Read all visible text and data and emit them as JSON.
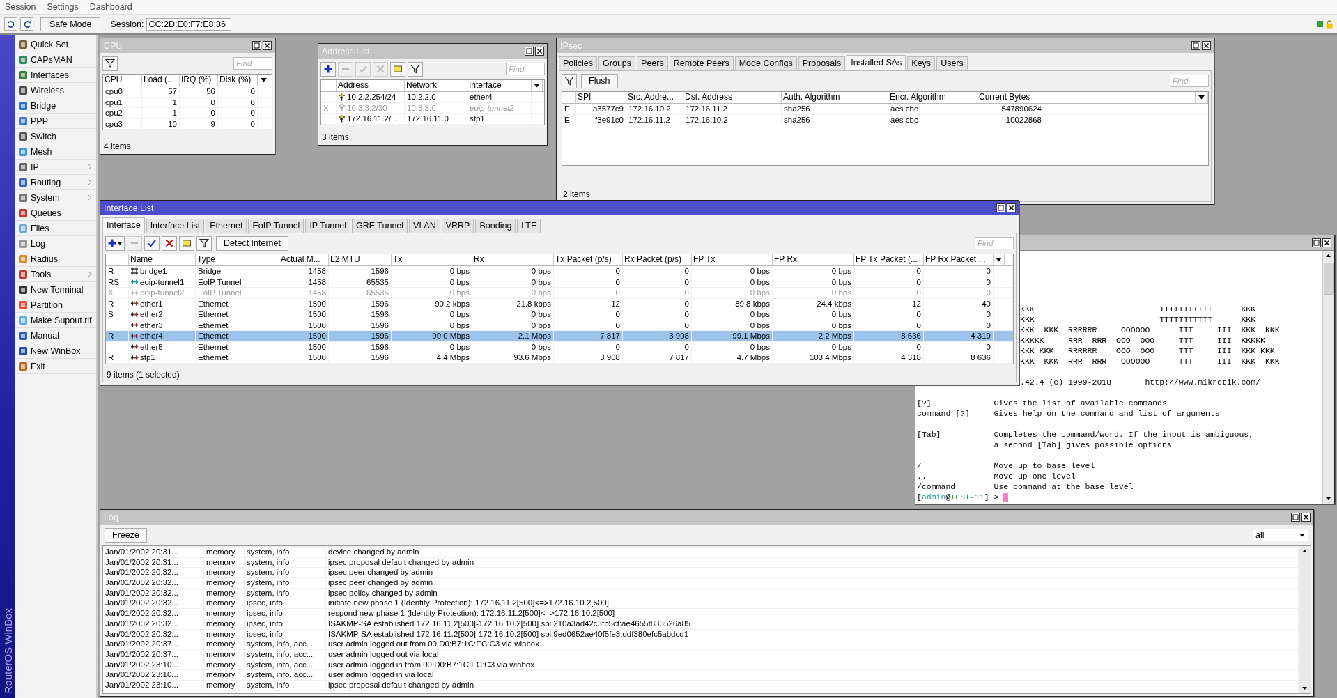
{
  "menu": [
    "Session",
    "Settings",
    "Dashboard"
  ],
  "toolbar": {
    "safe_mode": "Safe Mode",
    "session_label": "Session:",
    "session_value": "CC:2D:E0:F7:E8:86"
  },
  "sidebar": {
    "brand": "RouterOS WinBox",
    "items": [
      {
        "label": "Quick Set",
        "has_submenu": false
      },
      {
        "label": "CAPsMAN",
        "has_submenu": false
      },
      {
        "label": "Interfaces",
        "has_submenu": false
      },
      {
        "label": "Wireless",
        "has_submenu": false
      },
      {
        "label": "Bridge",
        "has_submenu": false
      },
      {
        "label": "PPP",
        "has_submenu": false
      },
      {
        "label": "Switch",
        "has_submenu": false
      },
      {
        "label": "Mesh",
        "has_submenu": false
      },
      {
        "label": "IP",
        "has_submenu": true
      },
      {
        "label": "Routing",
        "has_submenu": true
      },
      {
        "label": "System",
        "has_submenu": true
      },
      {
        "label": "Queues",
        "has_submenu": false
      },
      {
        "label": "Files",
        "has_submenu": false
      },
      {
        "label": "Log",
        "has_submenu": false
      },
      {
        "label": "Radius",
        "has_submenu": false
      },
      {
        "label": "Tools",
        "has_submenu": true
      },
      {
        "label": "New Terminal",
        "has_submenu": false
      },
      {
        "label": "Partition",
        "has_submenu": false
      },
      {
        "label": "Make Supout.rif",
        "has_submenu": false
      },
      {
        "label": "Manual",
        "has_submenu": false
      },
      {
        "label": "New WinBox",
        "has_submenu": false
      },
      {
        "label": "Exit",
        "has_submenu": false
      }
    ]
  },
  "cpu_window": {
    "title": "CPU",
    "find": {
      "placeholder": "Find"
    },
    "columns": [
      "CPU",
      "Load (...",
      "IRQ (%)",
      "Disk (%)"
    ],
    "rows": [
      [
        "cpu0",
        "57",
        "56",
        "0"
      ],
      [
        "cpu1",
        "1",
        "0",
        "0"
      ],
      [
        "cpu2",
        "1",
        "0",
        "0"
      ],
      [
        "cpu3",
        "10",
        "9",
        "0"
      ]
    ],
    "footer": "4 items"
  },
  "address_window": {
    "title": "Address List",
    "find": {
      "placeholder": "Find"
    },
    "tools": [
      {
        "kind": "add",
        "disabled": false
      },
      {
        "kind": "remove",
        "disabled": true
      },
      {
        "kind": "enable",
        "disabled": true
      },
      {
        "kind": "disable",
        "disabled": true
      },
      {
        "kind": "comment",
        "disabled": false
      },
      {
        "kind": "filter",
        "disabled": false
      }
    ],
    "columns": [
      "Address",
      "Network",
      "Interface"
    ],
    "rows": [
      {
        "address": "10.2.2.254/24",
        "network": "10.2.2.0",
        "interface": "ether4",
        "disabled": false
      },
      {
        "flag": "X",
        "address": "10.3.3.2/30",
        "network": "10.3.3.0",
        "interface": "eoip-tunnel2",
        "disabled": true
      },
      {
        "address": "172.16.11.2/...",
        "network": "172.16.11.0",
        "interface": "sfp1",
        "disabled": false
      }
    ],
    "footer": "3 items"
  },
  "ipsec_window": {
    "title": "IPsec",
    "tabs": [
      {
        "label": "Policies",
        "selected": false
      },
      {
        "label": "Groups",
        "selected": false
      },
      {
        "label": "Peers",
        "selected": false
      },
      {
        "label": "Remote Peers",
        "selected": false
      },
      {
        "label": "Mode Configs",
        "selected": false
      },
      {
        "label": "Proposals",
        "selected": false
      },
      {
        "label": "Installed SAs",
        "selected": true
      },
      {
        "label": "Keys",
        "selected": false
      },
      {
        "label": "Users",
        "selected": false
      }
    ],
    "flush": "Flush",
    "find": {
      "placeholder": "Find"
    },
    "columns": [
      "SPI",
      "Src. Addre...",
      "Dst. Address",
      "Auth. Algorithm",
      "Encr. Algorithm",
      "Current Bytes"
    ],
    "rows": [
      {
        "flag": "E",
        "cells": [
          "a3577c9",
          "172.16.10.2",
          "172.16.11.2",
          "sha256",
          "aes cbc",
          "547890624"
        ]
      },
      {
        "flag": "E",
        "cells": [
          "f3e91c0",
          "172.16.11.2",
          "172.16.10.2",
          "sha256",
          "aes cbc",
          "10022868"
        ]
      }
    ],
    "footer": "2 items"
  },
  "interface_window": {
    "title": "Interface List",
    "tabs": [
      {
        "label": "Interface",
        "selected": true
      },
      {
        "label": "Interface List",
        "selected": false
      },
      {
        "label": "Ethernet",
        "selected": false
      },
      {
        "label": "EoIP Tunnel",
        "selected": false
      },
      {
        "label": "IP Tunnel",
        "selected": false
      },
      {
        "label": "GRE Tunnel",
        "selected": false
      },
      {
        "label": "VLAN",
        "selected": false
      },
      {
        "label": "VRRP",
        "selected": false
      },
      {
        "label": "Bonding",
        "selected": false
      },
      {
        "label": "LTE",
        "selected": false
      }
    ],
    "tools": [
      {
        "kind": "add",
        "disabled": false
      },
      {
        "kind": "remove",
        "disabled": true
      },
      {
        "kind": "enable",
        "disabled": false
      },
      {
        "kind": "disable",
        "disabled": false
      },
      {
        "kind": "comment",
        "disabled": false
      },
      {
        "kind": "filter",
        "disabled": false
      }
    ],
    "detect": "Detect Internet",
    "find": {
      "placeholder": "Find"
    },
    "columns": [
      "Name",
      "Type",
      "Actual M...",
      "L2 MTU",
      "Tx",
      "Rx",
      "Tx Packet (p/s)",
      "Rx Packet (p/s)",
      "FP Tx",
      "FP Rx",
      "FP Tx Packet (...",
      "FP Rx Packet ..."
    ],
    "rows": [
      {
        "flag": "R",
        "kind": "bridge",
        "name": "bridge1",
        "type": "Bridge",
        "values": [
          "1458",
          "1596",
          "0 bps",
          "0 bps",
          "0",
          "0",
          "0 bps",
          "0 bps",
          "0",
          "0"
        ],
        "disabled": false,
        "selected": false
      },
      {
        "flag": "RS",
        "kind": "tunnel",
        "name": "eoip-tunnel1",
        "type": "EoIP Tunnel",
        "values": [
          "1458",
          "65535",
          "0 bps",
          "0 bps",
          "0",
          "0",
          "0 bps",
          "0 bps",
          "0",
          "0"
        ],
        "disabled": false,
        "selected": false
      },
      {
        "flag": "X",
        "kind": "tunnel",
        "name": "eoip-tunnel2",
        "type": "EoIP Tunnel",
        "values": [
          "1458",
          "65535",
          "0 bps",
          "0 bps",
          "0",
          "0",
          "0 bps",
          "0 bps",
          "0",
          "0"
        ],
        "disabled": true,
        "selected": false
      },
      {
        "flag": "R",
        "kind": "ethernet",
        "name": "ether1",
        "type": "Ethernet",
        "values": [
          "1500",
          "1596",
          "90.2 kbps",
          "21.8 kbps",
          "12",
          "0",
          "89.8 kbps",
          "24.4 kbps",
          "12",
          "40"
        ],
        "disabled": false,
        "selected": false
      },
      {
        "flag": "S",
        "kind": "ethernet",
        "name": "ether2",
        "type": "Ethernet",
        "values": [
          "1500",
          "1596",
          "0 bps",
          "0 bps",
          "0",
          "0",
          "0 bps",
          "0 bps",
          "0",
          "0"
        ],
        "disabled": false,
        "selected": false
      },
      {
        "kind": "ethernet",
        "name": "ether3",
        "type": "Ethernet",
        "values": [
          "1500",
          "1596",
          "0 bps",
          "0 bps",
          "0",
          "0",
          "0 bps",
          "0 bps",
          "0",
          "0"
        ],
        "disabled": false,
        "selected": false
      },
      {
        "flag": "R",
        "kind": "ethernet",
        "name": "ether4",
        "type": "Ethernet",
        "values": [
          "1500",
          "1596",
          "90.0 Mbps",
          "2.1 Mbps",
          "7 817",
          "3 908",
          "99.1 Mbps",
          "2.2 Mbps",
          "8 636",
          "4 319"
        ],
        "disabled": false,
        "selected": true
      },
      {
        "kind": "ethernet",
        "name": "ether5",
        "type": "Ethernet",
        "values": [
          "1500",
          "1596",
          "0 bps",
          "0 bps",
          "0",
          "0",
          "0 bps",
          "0 bps",
          "0",
          "0"
        ],
        "disabled": false,
        "selected": false
      },
      {
        "flag": "R",
        "kind": "ethernet",
        "name": "sfp1",
        "type": "Ethernet",
        "values": [
          "1500",
          "1596",
          "4.4 Mbps",
          "93.6 Mbps",
          "3 908",
          "7 817",
          "4.7 Mbps",
          "103.4 Mbps",
          "4 318",
          "8 636"
        ],
        "disabled": false,
        "selected": false
      }
    ],
    "footer": "9 items (1 selected)"
  },
  "terminal": {
    "banner": [
      "KKK                          TTTTTTTTTTT      KKK",
      "KKK                          TTTTTTTTTTT      KKK",
      "KKK  KKK  RRRRRR     OOOOOO      TTT     III  KKK  KKK",
      "KKKKK     RRR  RRR  OOO  OOO     TTT     III  KKKKK",
      "KKK KKK   RRRRRR    OOO  OOO     TTT     III  KKK KKK",
      "KKK  KKK  RRR  RRR   OOOOOO      TTT     III  KKK  KKK"
    ],
    "version": ".42.4 (c) 1999-2018       http://www.mikrotik.com/",
    "help_groups": [
      [
        "[?]             Gives the list of available commands",
        "command [?]     Gives help on the command and list of arguments"
      ],
      [
        "[Tab]           Completes the command/word. If the input is ambiguous,",
        "                a second [Tab] gives possible options"
      ],
      [
        "/               Move up to base level",
        "..              Move up one level",
        "/command        Use command at the base level"
      ]
    ],
    "prompt": {
      "open": "[",
      "user": "admin",
      "at": "@",
      "host": "TEST-11",
      "close": "] >"
    }
  },
  "log_window": {
    "title": "Log",
    "freeze": "Freeze",
    "filter": "all",
    "rows": [
      [
        "Jan/01/2002 20:31...",
        "memory",
        "system, info",
        "device changed by admin"
      ],
      [
        "Jan/01/2002 20:31...",
        "memory",
        "system, info",
        "ipsec proposal default changed by admin"
      ],
      [
        "Jan/01/2002 20:32...",
        "memory",
        "system, info",
        "ipsec peer changed by admin"
      ],
      [
        "Jan/01/2002 20:32...",
        "memory",
        "system, info",
        "ipsec peer changed by admin"
      ],
      [
        "Jan/01/2002 20:32...",
        "memory",
        "system, info",
        "ipsec policy changed by admin"
      ],
      [
        "Jan/01/2002 20:32...",
        "memory",
        "ipsec, info",
        "initiate new phase 1 (Identity Protection): 172.16.11.2[500]<=>172.16.10.2[500]"
      ],
      [
        "Jan/01/2002 20:32...",
        "memory",
        "ipsec, info",
        "respond new phase 1 (Identity Protection): 172.16.11.2[500]<=>172.16.10.2[500]"
      ],
      [
        "Jan/01/2002 20:32...",
        "memory",
        "ipsec, info",
        "ISAKMP-SA established 172.16.11.2[500]-172.16.10.2[500] spi:210a3ad42c3fb5cf:ae4655f833526a85"
      ],
      [
        "Jan/01/2002 20:32...",
        "memory",
        "ipsec, info",
        "ISAKMP-SA established 172.16.11.2[500]-172.16.10.2[500] spi:9ed0652ae40f5fe3:ddf380efc5abdcd1"
      ],
      [
        "Jan/01/2002 20:37...",
        "memory",
        "system, info, acc...",
        "user admin logged out from 00:D0:B7:1C:EC:C3 via winbox"
      ],
      [
        "Jan/01/2002 20:37...",
        "memory",
        "system, info, acc...",
        "user admin logged out via local"
      ],
      [
        "Jan/01/2002 23:10...",
        "memory",
        "system, info, acc...",
        "user admin logged in from 00:D0:B7:1C:EC:C3 via winbox"
      ],
      [
        "Jan/01/2002 23:10...",
        "memory",
        "system, info, acc...",
        "user admin logged in via local"
      ],
      [
        "Jan/01/2002 23:10...",
        "memory",
        "system, info",
        "ipsec proposal default changed by admin"
      ]
    ]
  }
}
